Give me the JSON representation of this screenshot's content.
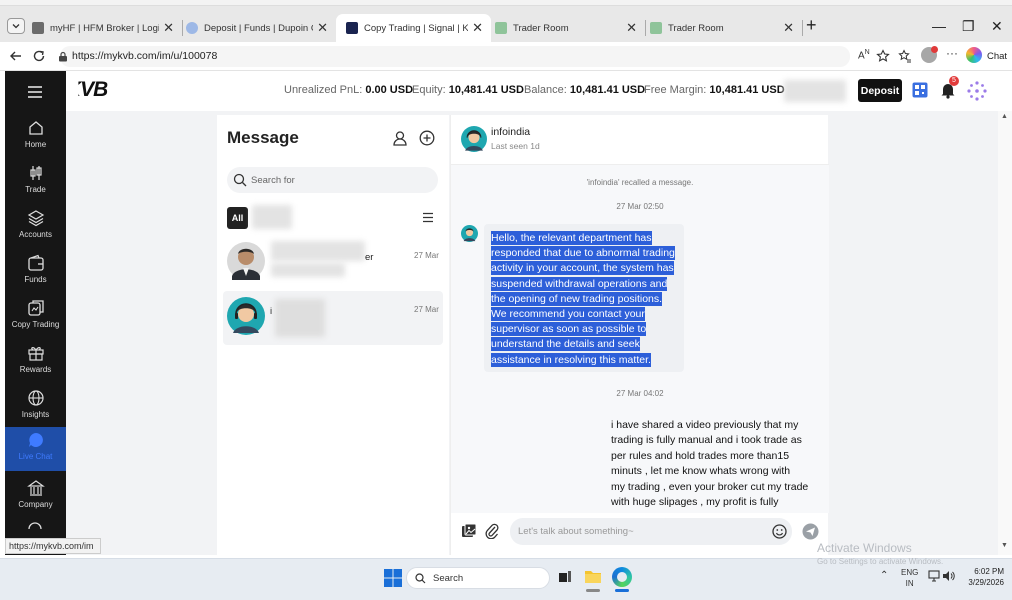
{
  "browser": {
    "tabs": [
      {
        "title": "myHF | HFM Broker | Login",
        "icon_color": "#6b6b6b",
        "active": false
      },
      {
        "title": "Deposit | Funds | Dupoin Client Ar",
        "icon_color": "#9db8e6",
        "active": false
      },
      {
        "title": "Copy Trading | Signal | KVB",
        "icon_color": "#1a2450",
        "active": true
      },
      {
        "title": "Trader Room",
        "icon_color": "#8fc49a",
        "active": false
      },
      {
        "title": "Trader Room",
        "icon_color": "#8fc49a",
        "active": false
      }
    ],
    "url": "https://mykvb.com/im/u/100078",
    "chat_label": "Chat",
    "status_url": "https://mykvb.com/im"
  },
  "header": {
    "logo": "KVB",
    "stats": [
      {
        "label": "Unrealized PnL:",
        "value": "0.00 USD"
      },
      {
        "label": "Equity:",
        "value": "10,481.41 USD"
      },
      {
        "label": "Balance:",
        "value": "10,481.41 USD"
      },
      {
        "label": "Free Margin:",
        "value": "10,481.41 USD"
      }
    ],
    "deposit_label": "Deposit",
    "notification_count": "5"
  },
  "sidebar": {
    "items": [
      {
        "label": "Home",
        "icon": "home-icon"
      },
      {
        "label": "Trade",
        "icon": "candles-icon"
      },
      {
        "label": "Accounts",
        "icon": "layers-icon"
      },
      {
        "label": "Funds",
        "icon": "wallet-icon"
      },
      {
        "label": "Copy Trading",
        "icon": "copy-icon"
      },
      {
        "label": "Rewards",
        "icon": "gift-icon"
      },
      {
        "label": "Insights",
        "icon": "globe-icon"
      },
      {
        "label": "Live Chat",
        "icon": "chat-icon",
        "active": true
      },
      {
        "label": "Company",
        "icon": "building-icon"
      }
    ]
  },
  "messages": {
    "title": "Message",
    "search_placeholder": "Search for",
    "filter_all": "All",
    "chats": [
      {
        "name_fragment": "er",
        "date": "27 Mar"
      },
      {
        "name_fragment": "i",
        "date": "27 Mar",
        "selected": true
      }
    ]
  },
  "chat": {
    "contact_name": "infoindia",
    "last_seen": "Last seen 1d",
    "recalled_notice": "'infoindia' recalled a message.",
    "time1": "27 Mar 02:50",
    "agent_message_lines": [
      "Hello, the relevant department has",
      "responded that due to abnormal trading",
      "activity in your account, the system has",
      "suspended withdrawal operations and",
      "the opening of new trading positions.",
      "We recommend you contact your",
      "supervisor as soon as possible to",
      "understand the details and seek",
      "assistance in resolving this matter."
    ],
    "time2": "27 Mar 04:02",
    "user_message_lines": [
      "i have shared a video previously that my",
      "trading is fully manual and i took trade as",
      "per rules and hold trades more than15",
      "minuts , let me know whats wrong with",
      "my trading , even your broker cut my trade",
      "with huge slipages , my profit is fully"
    ],
    "input_placeholder": "Let's talk about something~"
  },
  "taskbar": {
    "search_label": "Search",
    "lang_top": "ENG",
    "lang_bottom": "IN",
    "time": "6:02 PM",
    "date": "3/29/2026"
  },
  "watermark": {
    "title": "Activate Windows",
    "subtitle": "Go to Settings to activate Windows."
  }
}
